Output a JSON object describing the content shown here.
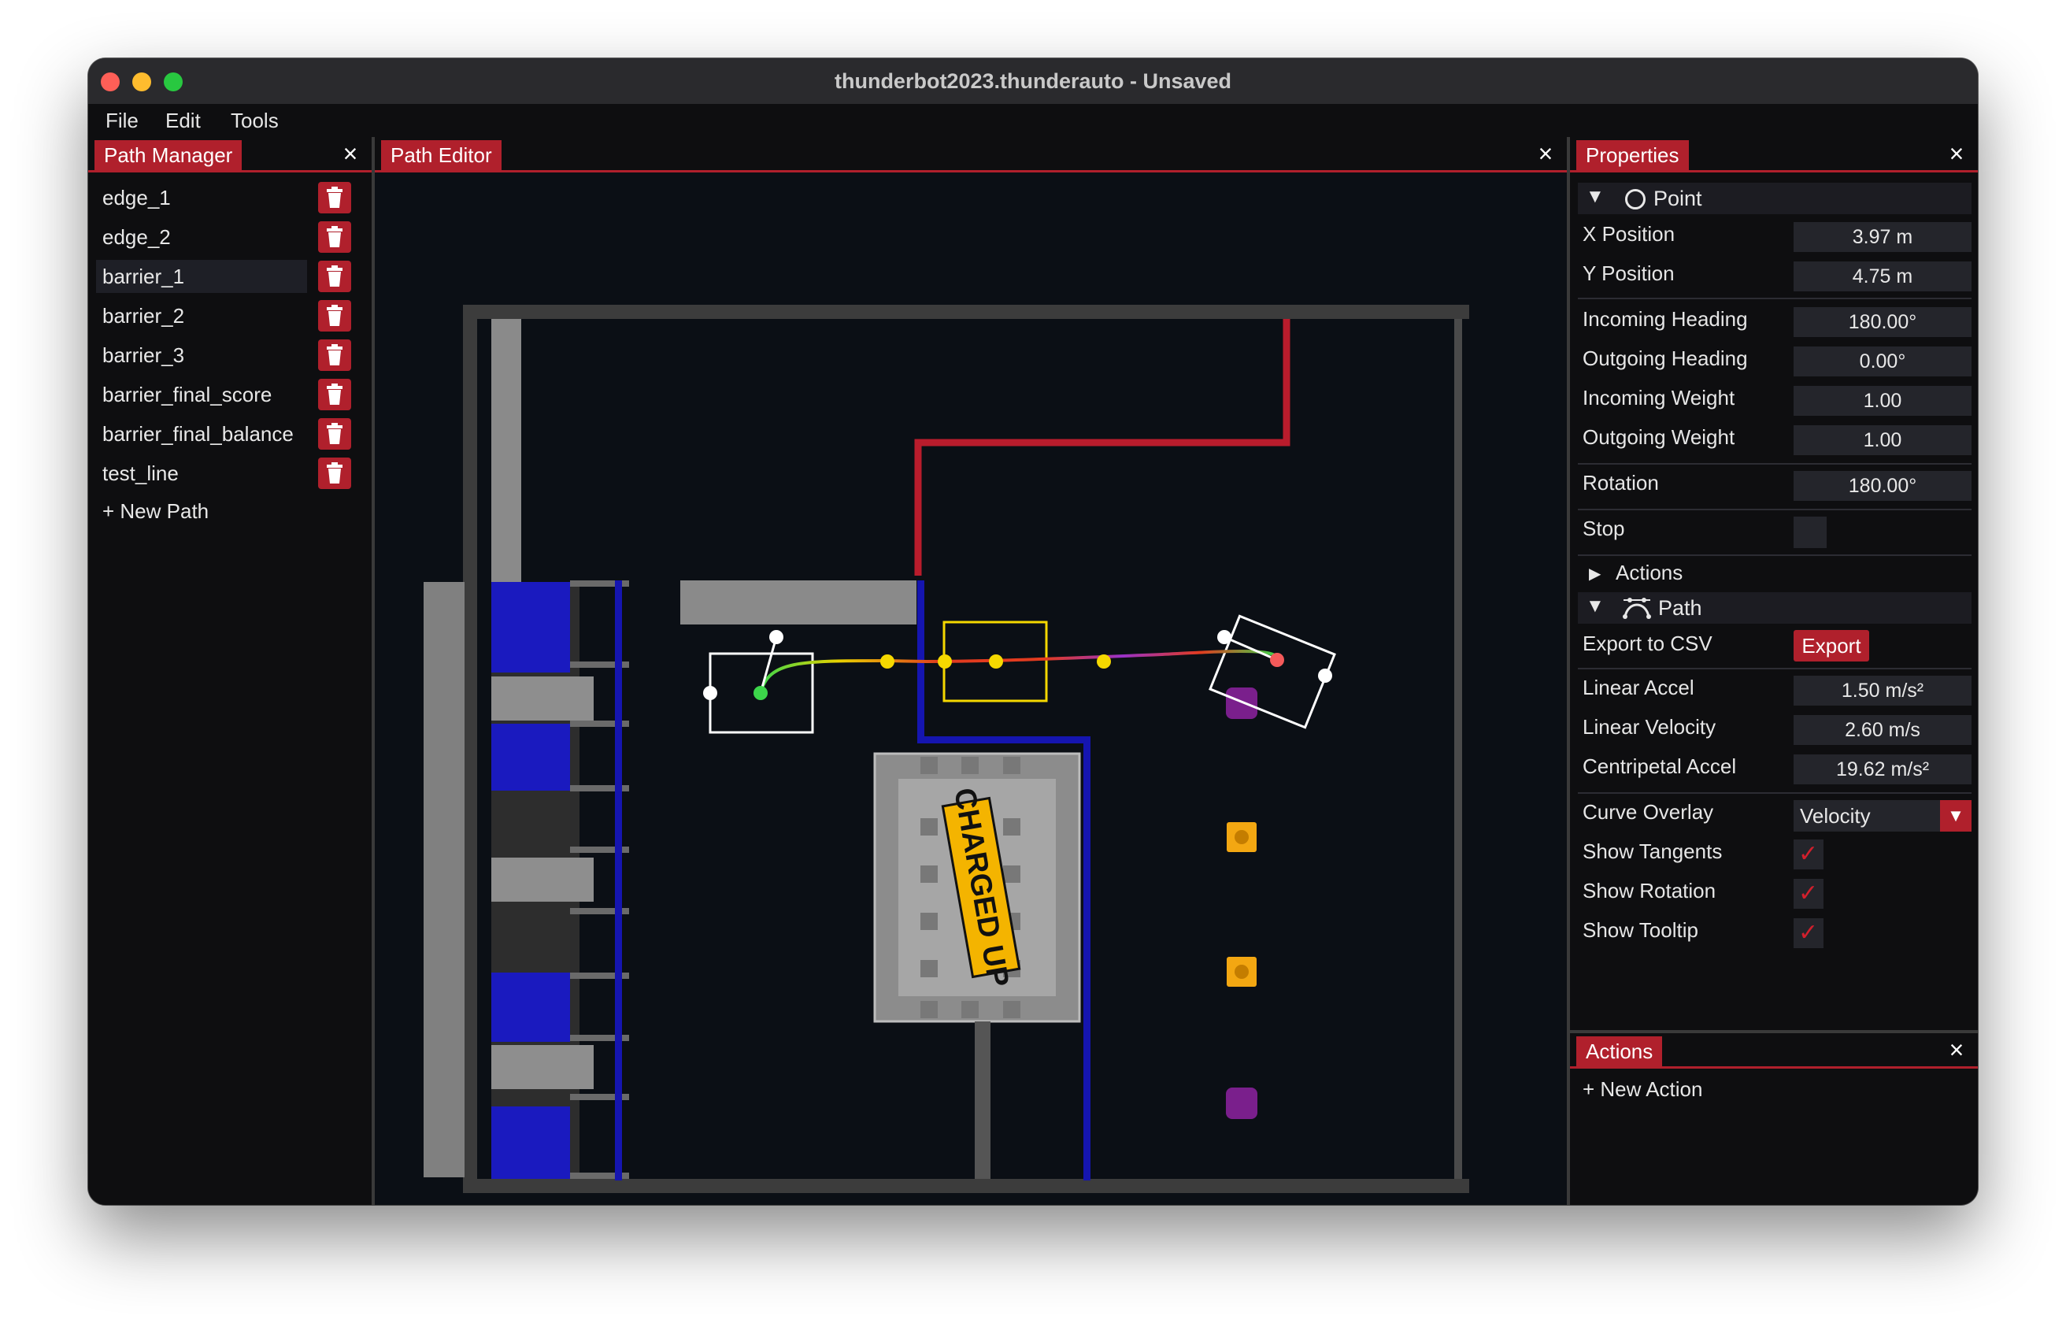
{
  "window": {
    "title": "thunderbot2023.thunderauto - Unsaved"
  },
  "menu": [
    "File",
    "Edit",
    "Tools"
  ],
  "path_manager": {
    "title": "Path Manager",
    "paths": [
      {
        "name": "edge_1",
        "selected": false
      },
      {
        "name": "edge_2",
        "selected": false
      },
      {
        "name": "barrier_1",
        "selected": true
      },
      {
        "name": "barrier_2",
        "selected": false
      },
      {
        "name": "barrier_3",
        "selected": false
      },
      {
        "name": "barrier_final_score",
        "selected": false
      },
      {
        "name": "barrier_final_balance",
        "selected": false
      },
      {
        "name": "test_line",
        "selected": false
      }
    ],
    "new_path_label": "+ New Path"
  },
  "path_editor": {
    "title": "Path Editor",
    "logo_text": "CHARGED UP",
    "colors": {
      "field_bg": "#0b0f15",
      "wall": "#3a3a3a",
      "blue_zone": "#1a1abf",
      "blue_line": "#1515b0",
      "red_line": "#b91c2c",
      "waypoint": "#f5d800",
      "cone": "#f3a712",
      "cube": "#7a1f8c"
    }
  },
  "properties": {
    "title": "Properties",
    "point_section": "Point",
    "fields": {
      "x_position": {
        "label": "X Position",
        "value": "3.97 m"
      },
      "y_position": {
        "label": "Y Position",
        "value": "4.75 m"
      },
      "incoming_heading": {
        "label": "Incoming Heading",
        "value": "180.00°"
      },
      "outgoing_heading": {
        "label": "Outgoing Heading",
        "value": "0.00°"
      },
      "incoming_weight": {
        "label": "Incoming Weight",
        "value": "1.00"
      },
      "outgoing_weight": {
        "label": "Outgoing Weight",
        "value": "1.00"
      },
      "rotation": {
        "label": "Rotation",
        "value": "180.00°"
      },
      "stop": {
        "label": "Stop",
        "checked": false
      }
    },
    "actions_section": "Actions",
    "path_section": "Path",
    "path_fields": {
      "export_csv": {
        "label": "Export to CSV",
        "button": "Export"
      },
      "linear_accel": {
        "label": "Linear Accel",
        "value": "1.50 m/s²"
      },
      "linear_velocity": {
        "label": "Linear Velocity",
        "value": "2.60 m/s"
      },
      "centripetal_accel": {
        "label": "Centripetal Accel",
        "value": "19.62 m/s²"
      },
      "curve_overlay": {
        "label": "Curve Overlay",
        "value": "Velocity"
      },
      "show_tangents": {
        "label": "Show Tangents",
        "checked": true
      },
      "show_rotation": {
        "label": "Show Rotation",
        "checked": true
      },
      "show_tooltip": {
        "label": "Show Tooltip",
        "checked": true
      }
    }
  },
  "actions_panel": {
    "title": "Actions",
    "new_action_label": "+ New Action"
  }
}
